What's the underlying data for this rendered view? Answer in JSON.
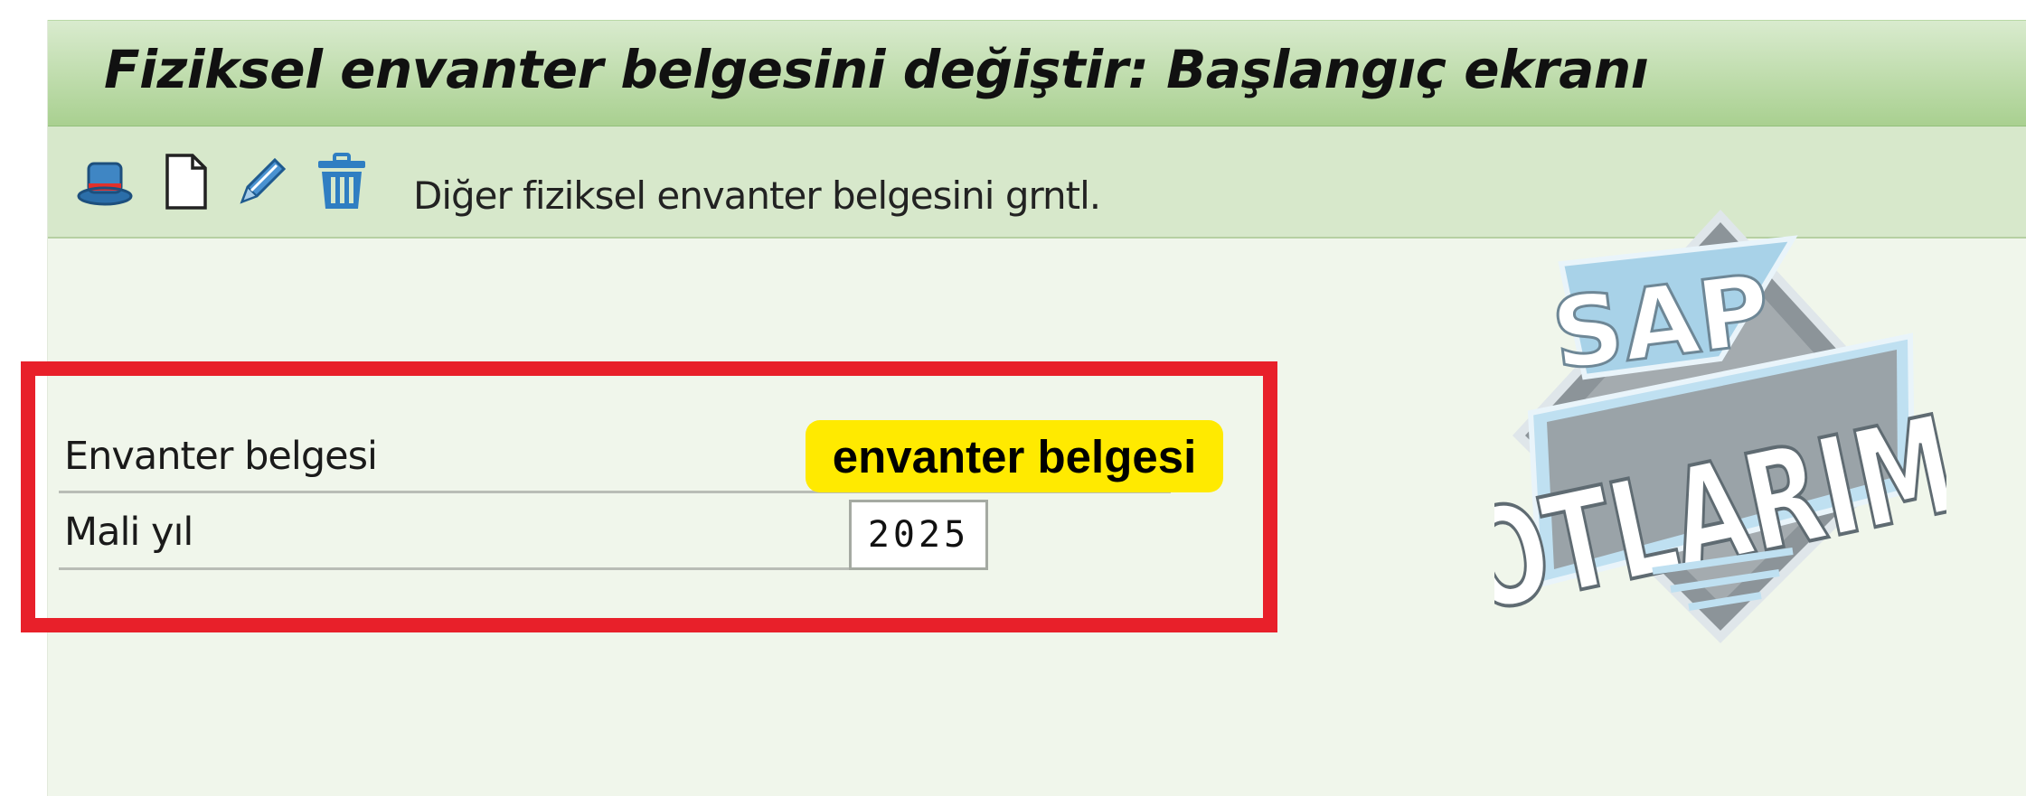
{
  "window": {
    "title": "Fiziksel envanter belgesini değiştir: Başlangıç ekranı"
  },
  "toolbar": {
    "icons": [
      "hat-icon",
      "new-document-icon",
      "pencil-icon",
      "trash-icon"
    ],
    "other_document_label": "Diğer fiziksel envanter belgesini grntl."
  },
  "form": {
    "inventory_document_label": "Envanter belgesi",
    "inventory_document_value": "",
    "fiscal_year_label": "Mali yıl",
    "fiscal_year_value": "2025"
  },
  "annotation": {
    "callout_text": "envanter belgesi",
    "frame_color": "#e8202a",
    "callout_color": "#ffea00"
  },
  "watermark": {
    "line1": "SAP",
    "line2": "NOTLARIM"
  }
}
